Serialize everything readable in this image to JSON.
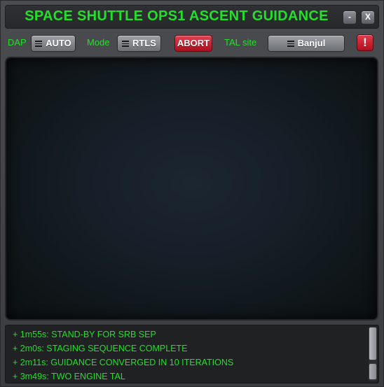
{
  "window": {
    "title": "SPACE SHUTTLE OPS1 ASCENT GUIDANCE",
    "minimize_label": "-",
    "close_label": "X"
  },
  "toolbar": {
    "dap_label": "DAP",
    "dap_value": "AUTO",
    "mode_label": "Mode",
    "mode_value": "RTLS",
    "abort_label": "ABORT",
    "tal_label": "TAL site",
    "tal_value": "Banjul",
    "alert_label": "!"
  },
  "log": {
    "lines": [
      "+ 1m55s: STAND-BY FOR SRB SEP",
      "+ 2m0s: STAGING SEQUENCE COMPLETE",
      "+ 2m11s: GUIDANCE CONVERGED IN 10 ITERATIONS",
      "+ 3m49s: TWO ENGINE TAL"
    ]
  },
  "colors": {
    "accent_green": "#22e02a",
    "abort_red": "#c0192a"
  },
  "icons": {
    "menu": "menu-icon",
    "alert": "alert-icon"
  }
}
